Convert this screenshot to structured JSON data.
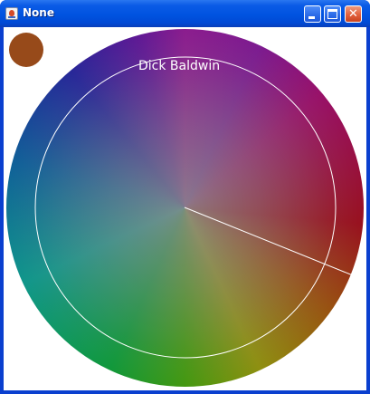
{
  "window": {
    "title": "None"
  },
  "canvas": {
    "author_text": "Dick Baldwin",
    "swatch_color": "#974a1a",
    "outline_color": "#ffffff"
  }
}
